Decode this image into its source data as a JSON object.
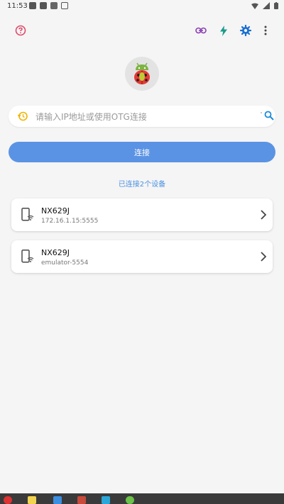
{
  "status_bar": {
    "time": "11:53"
  },
  "app": {
    "search": {
      "placeholder": "请输入IP地址或使用OTG连接",
      "value": ""
    },
    "connect_button": "连接",
    "connected_count": "已连接2个设备",
    "devices": [
      {
        "name": "NX629J",
        "address": "172.16.1.15:5555"
      },
      {
        "name": "NX629J",
        "address": "emulator-5554"
      }
    ]
  },
  "colors": {
    "accent": "#5b93e4",
    "help": "#e04a6a",
    "link": "#8b3fb4",
    "bolt": "#1a9a8a",
    "gear": "#1a6fd0"
  },
  "icons": [
    "help-icon",
    "link-icon",
    "bolt-icon",
    "gear-icon",
    "more-icon",
    "history-icon",
    "search-icon",
    "phone-wifi-icon",
    "chevron-right-icon"
  ]
}
